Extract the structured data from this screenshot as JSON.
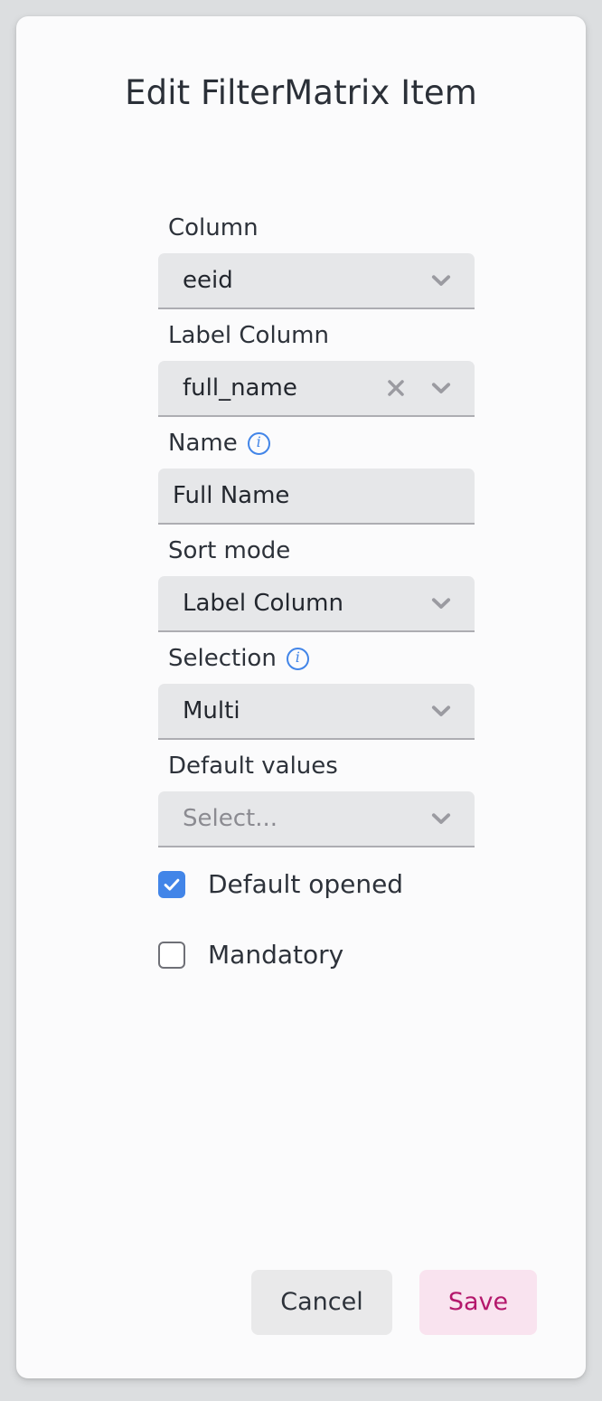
{
  "dialog": {
    "title": "Edit FilterMatrix Item"
  },
  "fields": [
    {
      "label": "Column",
      "kind": "select",
      "value": "eeid",
      "is_placeholder": false,
      "has_info": false,
      "has_clear": false
    },
    {
      "label": "Label Column",
      "kind": "select",
      "value": "full_name",
      "is_placeholder": false,
      "has_info": false,
      "has_clear": true
    },
    {
      "label": "Name",
      "kind": "text",
      "value": "Full Name",
      "is_placeholder": false,
      "has_info": true,
      "has_clear": false
    },
    {
      "label": "Sort mode",
      "kind": "select",
      "value": "Label Column",
      "is_placeholder": false,
      "has_info": false,
      "has_clear": false
    },
    {
      "label": "Selection",
      "kind": "select",
      "value": "Multi",
      "is_placeholder": false,
      "has_info": true,
      "has_clear": false
    },
    {
      "label": "Default values",
      "kind": "select",
      "value": "Select...",
      "is_placeholder": true,
      "has_info": false,
      "has_clear": false
    }
  ],
  "checkboxes": [
    {
      "label": "Default opened",
      "checked": true
    },
    {
      "label": "Mandatory",
      "checked": false
    }
  ],
  "actions": {
    "cancel_label": "Cancel",
    "save_label": "Save"
  },
  "icons": {
    "info": "info-icon",
    "clear": "clear-icon",
    "chevron": "chevron-down-icon",
    "check": "check-icon"
  },
  "colors": {
    "page_background": "#dcdee0",
    "dialog_background": "#fbfbfc",
    "field_background": "#e6e7e9",
    "field_underline": "#adadb2",
    "accent_blue": "#4285e8",
    "save_background": "#f9e3ef",
    "save_text": "#b4186c",
    "cancel_background": "#e9e9ea",
    "text_primary": "#2d323a",
    "text_placeholder": "#8b8b91",
    "icon_gray": "#9b9ba1"
  }
}
